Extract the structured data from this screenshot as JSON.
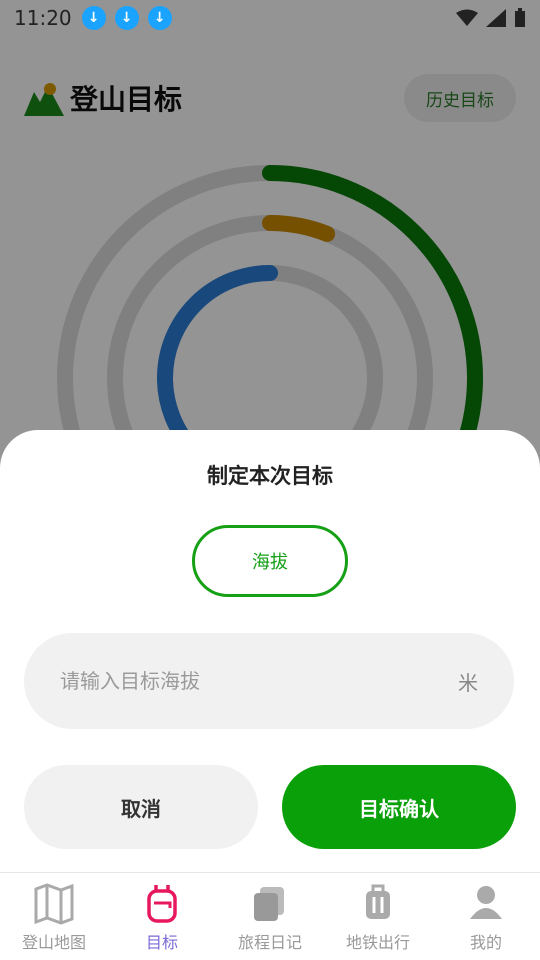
{
  "status_bar": {
    "time": "11:20",
    "download_count": 3
  },
  "header": {
    "title": "登山目标",
    "history_label": "历史目标"
  },
  "rings": [
    {
      "color": "#0a7a0a",
      "progress": 0.35
    },
    {
      "color": "#c98a00",
      "progress": 0.06
    },
    {
      "color": "#2a7dd6",
      "progress": 0.62
    }
  ],
  "dialog": {
    "title": "制定本次目标",
    "type_option": "海拔",
    "input_placeholder": "请输入目标海拔",
    "unit": "米",
    "cancel_label": "取消",
    "confirm_label": "目标确认"
  },
  "tabs": [
    {
      "label": "登山地图",
      "icon": "map-icon"
    },
    {
      "label": "目标",
      "icon": "backpack-icon",
      "active": true
    },
    {
      "label": "旅程日记",
      "icon": "diary-icon"
    },
    {
      "label": "地铁出行",
      "icon": "luggage-icon"
    },
    {
      "label": "我的",
      "icon": "user-icon"
    }
  ],
  "colors": {
    "accent": "#0aa00a",
    "active_tab": "#e8185f"
  }
}
